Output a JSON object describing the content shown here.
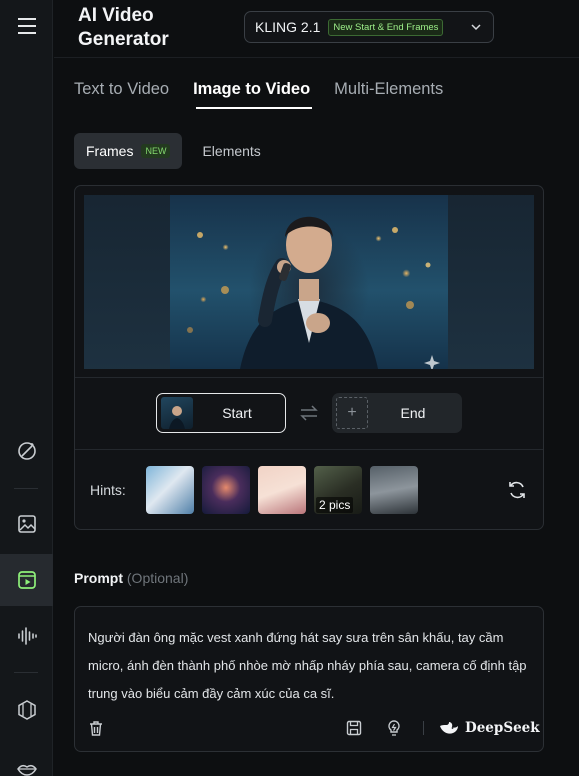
{
  "header": {
    "title": "AI Video Generator",
    "model": {
      "name": "KLING 2.1",
      "badge": "New Start & End Frames",
      "icon": "chevron-down-icon"
    }
  },
  "sidebar": {
    "items": [
      {
        "name": "menu",
        "icon": "hamburger-menu-icon"
      },
      {
        "name": "magic",
        "icon": "magic-wand-icon"
      },
      {
        "name": "image",
        "icon": "image-icon"
      },
      {
        "name": "video",
        "icon": "video-icon",
        "active": true
      },
      {
        "name": "audio",
        "icon": "audio-wave-icon"
      },
      {
        "name": "cube",
        "icon": "cube-icon"
      },
      {
        "name": "lips",
        "icon": "lips-icon"
      }
    ]
  },
  "tabs": [
    {
      "label": "Text to Video",
      "active": false
    },
    {
      "label": "Image to Video",
      "active": true
    },
    {
      "label": "Multi-Elements",
      "active": false
    }
  ],
  "subtabs": {
    "frames": {
      "label": "Frames",
      "badge": "NEW",
      "active": true
    },
    "elements": {
      "label": "Elements",
      "active": false
    }
  },
  "frames": {
    "start_label": "Start",
    "end_label": "End",
    "end_add_symbol": "+"
  },
  "hints": {
    "label": "Hints:",
    "items": [
      {
        "name": "hint-1"
      },
      {
        "name": "hint-2"
      },
      {
        "name": "hint-3"
      },
      {
        "name": "hint-4",
        "count": "2 pics"
      },
      {
        "name": "hint-5"
      }
    ]
  },
  "prompt": {
    "title": "Prompt",
    "optional": "(Optional)",
    "text": "Người đàn ông mặc vest xanh đứng hát say sưa trên sân khấu, tay cầm micro, ánh đèn thành phố nhòe mờ nhấp nháy phía sau, camera cố định tập trung vào biểu cảm đầy cảm xúc của ca sĩ.",
    "deepseek_label": "DeepSeek"
  },
  "colors": {
    "background": "#0d0f11",
    "badge_green": "#9ef08a",
    "active_tab": "#ffffff"
  }
}
